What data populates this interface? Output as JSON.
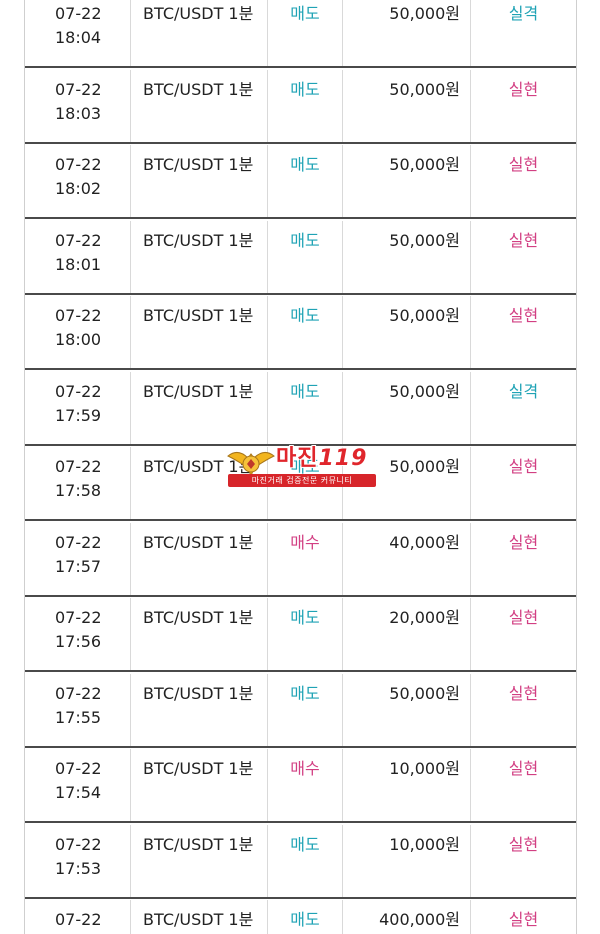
{
  "rows": [
    {
      "date": "07-22",
      "time": "18:04",
      "pair": "BTC/USDT 1분",
      "type": "매도",
      "amount": "50,000원",
      "result": "실격"
    },
    {
      "date": "07-22",
      "time": "18:03",
      "pair": "BTC/USDT 1분",
      "type": "매도",
      "amount": "50,000원",
      "result": "실현"
    },
    {
      "date": "07-22",
      "time": "18:02",
      "pair": "BTC/USDT 1분",
      "type": "매도",
      "amount": "50,000원",
      "result": "실현"
    },
    {
      "date": "07-22",
      "time": "18:01",
      "pair": "BTC/USDT 1분",
      "type": "매도",
      "amount": "50,000원",
      "result": "실현"
    },
    {
      "date": "07-22",
      "time": "18:00",
      "pair": "BTC/USDT 1분",
      "type": "매도",
      "amount": "50,000원",
      "result": "실현"
    },
    {
      "date": "07-22",
      "time": "17:59",
      "pair": "BTC/USDT 1분",
      "type": "매도",
      "amount": "50,000원",
      "result": "실격"
    },
    {
      "date": "07-22",
      "time": "17:58",
      "pair": "BTC/USDT 1분",
      "type": "매도",
      "amount": "50,000원",
      "result": "실현"
    },
    {
      "date": "07-22",
      "time": "17:57",
      "pair": "BTC/USDT 1분",
      "type": "매수",
      "amount": "40,000원",
      "result": "실현"
    },
    {
      "date": "07-22",
      "time": "17:56",
      "pair": "BTC/USDT 1분",
      "type": "매도",
      "amount": "20,000원",
      "result": "실현"
    },
    {
      "date": "07-22",
      "time": "17:55",
      "pair": "BTC/USDT 1분",
      "type": "매도",
      "amount": "50,000원",
      "result": "실현"
    },
    {
      "date": "07-22",
      "time": "17:54",
      "pair": "BTC/USDT 1분",
      "type": "매수",
      "amount": "10,000원",
      "result": "실현"
    },
    {
      "date": "07-22",
      "time": "17:53",
      "pair": "BTC/USDT 1분",
      "type": "매도",
      "amount": "10,000원",
      "result": "실현"
    },
    {
      "date": "07-22",
      "time": "",
      "pair": "BTC/USDT 1분",
      "type": "매도",
      "amount": "400,000원",
      "result": "실현"
    }
  ],
  "watermark": {
    "title": "마진",
    "number": "119",
    "subtitle": "마진거래 검증전문 커뮤니티"
  },
  "colors": {
    "sell": "#1fa3b5",
    "buy": "#d23f83",
    "profit": "#d23f83",
    "loss": "#1fa3b5",
    "brand_red": "#e0262c"
  }
}
